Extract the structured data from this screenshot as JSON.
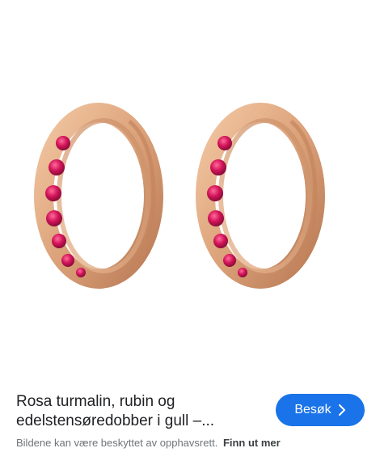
{
  "result": {
    "title": "Rosa turmalin, rubin og edelstensøredobber i gull –...",
    "copyright_notice": "Bildene kan være beskyttet av opphavsrett.",
    "learn_more_label": "Finn ut mer",
    "visit_button_label": "Besøk",
    "visit_icon": "chevron-right-icon",
    "image_subject": "gold-hoop-earrings-with-pink-stones"
  },
  "colors": {
    "accent": "#1a73e8",
    "title_text": "#202124",
    "meta_text": "#70757a",
    "gold": "#d9a27a",
    "stone": "#d01c5a"
  }
}
